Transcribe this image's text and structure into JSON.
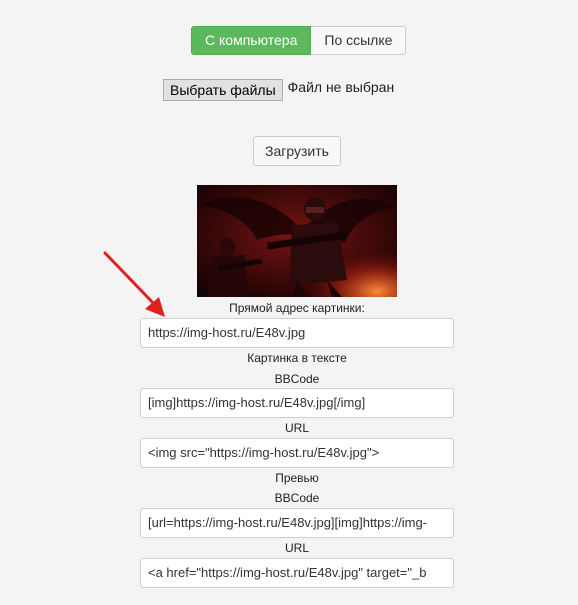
{
  "tabs": [
    {
      "label": "С компьютера",
      "active": true
    },
    {
      "label": "По ссылке",
      "active": false
    }
  ],
  "file_picker": {
    "button_label": "Выбрать файлы",
    "status": "Файл не выбран"
  },
  "upload_button": "Загрузить",
  "links": {
    "direct_label": "Прямой адрес картинки:",
    "direct_value": "https://img-host.ru/E48v.jpg",
    "inline_heading": "Картинка в тексте",
    "inline_bbcode_label": "BBCode",
    "inline_bbcode_value": "[img]https://img-host.ru/E48v.jpg[/img]",
    "inline_url_label": "URL",
    "inline_url_value": "<img src=\"https://img-host.ru/E48v.jpg\">",
    "preview_heading": "Превью",
    "preview_bbcode_label": "BBCode",
    "preview_bbcode_value": "[url=https://img-host.ru/E48v.jpg][img]https://img-",
    "preview_url_label": "URL",
    "preview_url_value": "<a href=\"https://img-host.ru/E48v.jpg\" target=\"_b"
  },
  "colors": {
    "active_tab": "#5cb85c",
    "arrow": "#e02020"
  }
}
